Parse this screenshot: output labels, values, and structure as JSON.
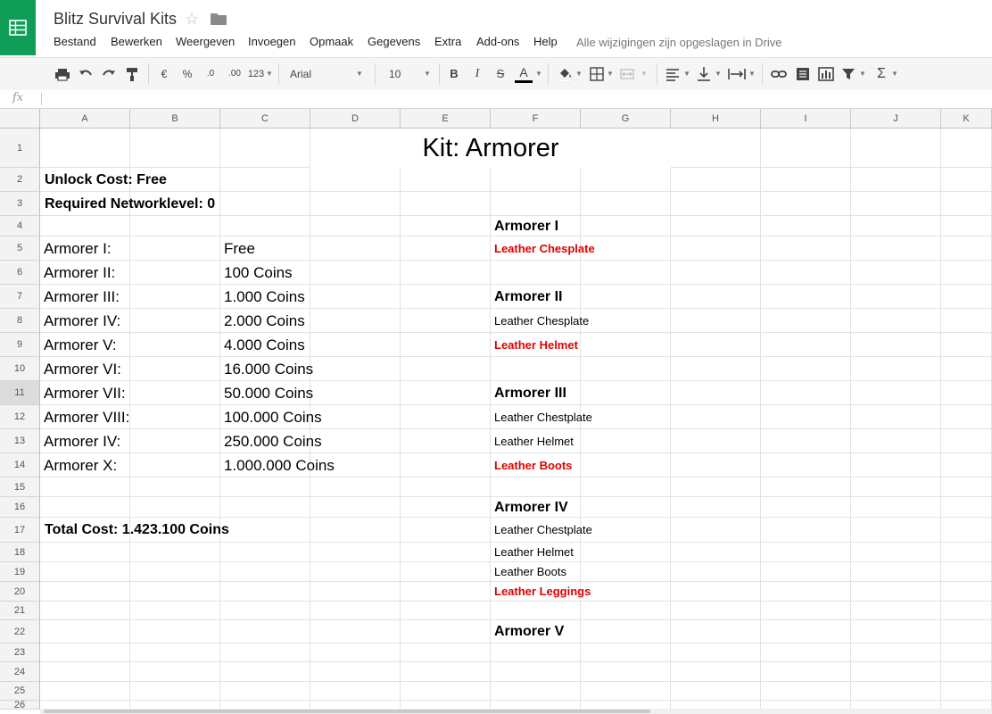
{
  "app": {
    "title": "Blitz Survival Kits",
    "save_status": "Alle wijzigingen zijn opgeslagen in Drive",
    "brand_color": "#0f9d58"
  },
  "menu": [
    "Bestand",
    "Bewerken",
    "Weergeven",
    "Invoegen",
    "Opmaak",
    "Gegevens",
    "Extra",
    "Add-ons",
    "Help"
  ],
  "toolbar": {
    "currency": "€",
    "percent": "%",
    "decrease_decimals": ".0",
    "increase_decimals": ".00",
    "more_formats": "123",
    "font": "Arial",
    "font_size": "10",
    "bold": "B",
    "italic": "I",
    "strikethrough": "S",
    "text_color": "A",
    "functions": "Σ",
    "icons": [
      "print-icon",
      "undo-icon",
      "redo-icon",
      "paint-format-icon",
      "fill-color-icon",
      "borders-icon",
      "merge-icon",
      "align-icon",
      "valign-icon",
      "wrap-icon",
      "link-icon",
      "comment-icon",
      "chart-icon",
      "filter-icon",
      "functions-icon"
    ]
  },
  "formula_bar": {
    "fx": "fx",
    "value": ""
  },
  "sheet": {
    "columns": [
      "A",
      "B",
      "C",
      "D",
      "E",
      "F",
      "G",
      "H",
      "I",
      "J",
      "K"
    ],
    "rows": [
      "1",
      "2",
      "3",
      "4",
      "5",
      "6",
      "7",
      "8",
      "9",
      "10",
      "11",
      "12",
      "13",
      "14",
      "15",
      "16",
      "17",
      "18",
      "19",
      "20",
      "21",
      "22",
      "23",
      "24",
      "25",
      "26"
    ],
    "selected_row": "11",
    "title": "Kit: Armorer",
    "unlock_cost": "Unlock Cost: Free",
    "required_level": "Required Networklevel: 0",
    "levels": [
      {
        "name": "Armorer I:",
        "cost": "Free"
      },
      {
        "name": "Armorer II:",
        "cost": "100 Coins"
      },
      {
        "name": "Armorer III:",
        "cost": "1.000 Coins"
      },
      {
        "name": "Armorer IV:",
        "cost": "2.000 Coins"
      },
      {
        "name": "Armorer V:",
        "cost": "4.000 Coins"
      },
      {
        "name": "Armorer VI:",
        "cost": "16.000 Coins"
      },
      {
        "name": "Armorer VII:",
        "cost": "50.000 Coins"
      },
      {
        "name": "Armorer VIII:",
        "cost": "100.000 Coins"
      },
      {
        "name": "Armorer IV:",
        "cost": "250.000 Coins"
      },
      {
        "name": "Armorer X:",
        "cost": "1.000.000 Coins"
      }
    ],
    "total_cost": "Total Cost: 1.423.100 Coins",
    "kit_items": {
      "h1": "Armorer I",
      "r5": "Leather Chesplate",
      "h2": "Armorer II",
      "r8": "Leather Chesplate",
      "r9": "Leather Helmet",
      "h3": "Armorer III",
      "r12": "Leather Chestplate",
      "r13": "Leather Helmet",
      "r14": "Leather Boots",
      "h4": "Armorer IV",
      "r17": "Leather Chestplate",
      "r18": "Leather Helmet",
      "r19": "Leather Boots",
      "r20": "Leather Leggings",
      "h5": "Armorer V"
    },
    "highlight_color": "#e00000"
  }
}
